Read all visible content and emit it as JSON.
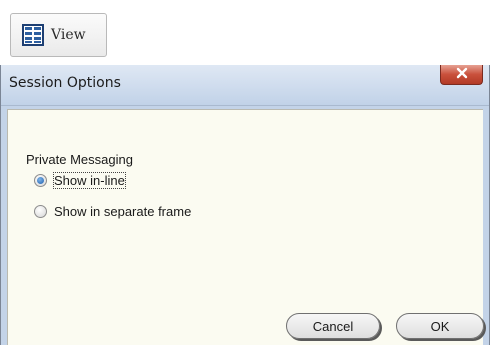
{
  "toolbar": {
    "view_label": "View",
    "view_icon": "view-grid-icon"
  },
  "dialog": {
    "title": "Session Options",
    "close_icon": "close-icon",
    "section_label": "Private Messaging",
    "options": [
      {
        "label": "Show in-line",
        "selected": true
      },
      {
        "label": "Show in separate frame",
        "selected": false
      }
    ],
    "cancel_label": "Cancel",
    "ok_label": "OK"
  },
  "colors": {
    "titlebar": "#c1d2e8",
    "content_bg": "#fbfbf1",
    "close_button": "#c9503b",
    "radio_selected": "#1f5fae"
  }
}
